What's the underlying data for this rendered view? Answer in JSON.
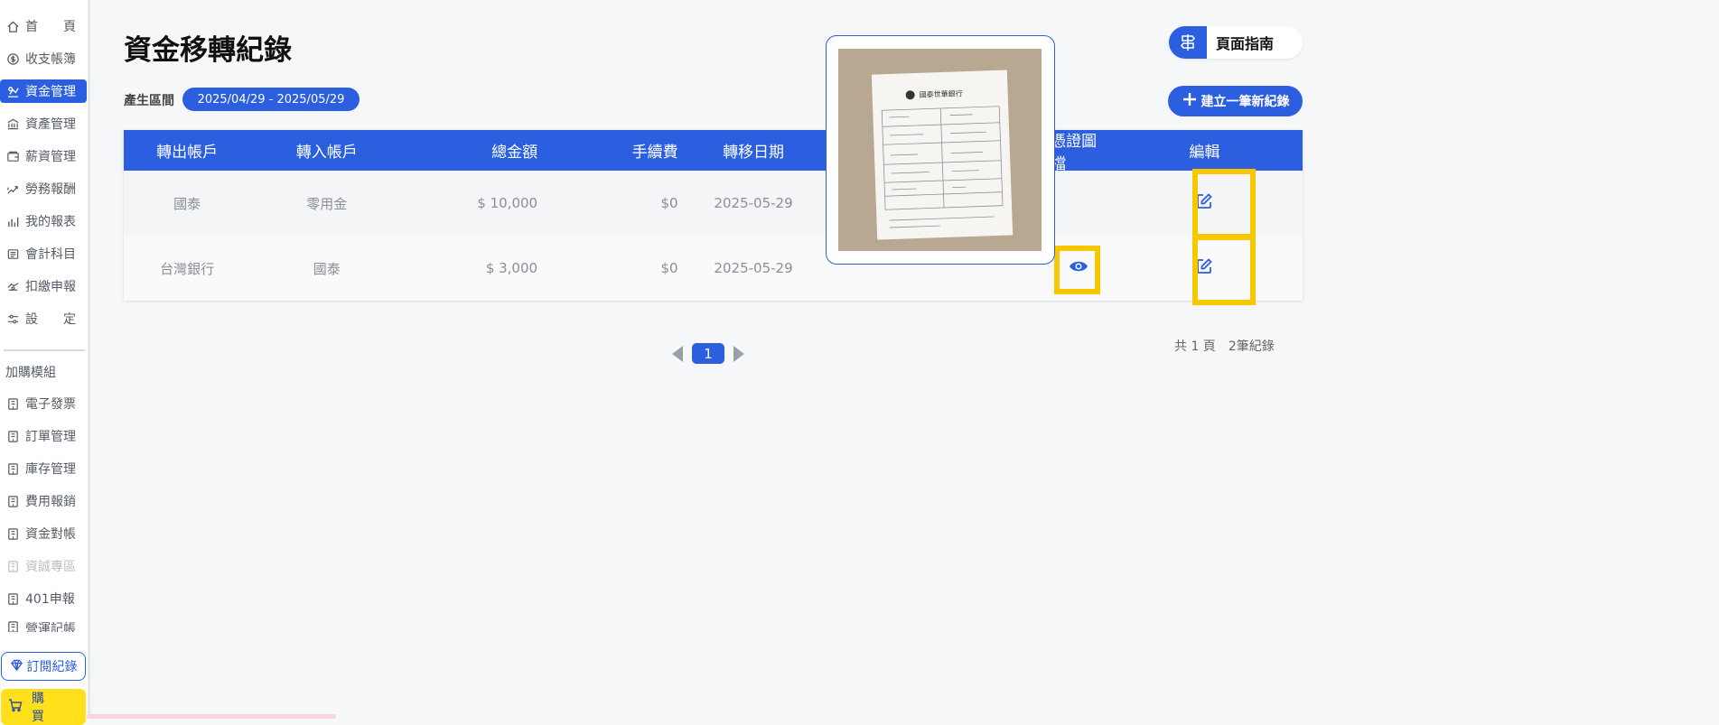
{
  "sidebar": {
    "items": [
      {
        "label": "首　　頁",
        "icon": "home-icon"
      },
      {
        "label": "收支帳簿",
        "icon": "dollar-circle-icon"
      },
      {
        "label": "資金管理",
        "icon": "transfer-icon"
      },
      {
        "label": "資產管理",
        "icon": "bank-icon"
      },
      {
        "label": "薪資管理",
        "icon": "wallet-icon"
      },
      {
        "label": "勞務報酬",
        "icon": "handshake-icon"
      },
      {
        "label": "我的報表",
        "icon": "chart-icon"
      },
      {
        "label": "會計科目",
        "icon": "ledger-icon"
      },
      {
        "label": "扣繳申報",
        "icon": "receipt-icon"
      },
      {
        "label": "設　　定",
        "icon": "sliders-icon"
      }
    ],
    "addon_section": "加購模組",
    "addon_items": [
      {
        "label": "電子發票",
        "icon": "module-icon"
      },
      {
        "label": "訂單管理",
        "icon": "module-icon"
      },
      {
        "label": "庫存管理",
        "icon": "module-icon"
      },
      {
        "label": "費用報銷",
        "icon": "module-icon"
      },
      {
        "label": "資金對帳",
        "icon": "module-icon"
      },
      {
        "label": "資誠專區",
        "icon": "module-icon"
      },
      {
        "label": "401申報",
        "icon": "module-icon"
      },
      {
        "label": "營運記帳",
        "icon": "module-icon"
      }
    ],
    "subscription_label": "訂閱紀錄",
    "buy_label": "購買"
  },
  "header": {
    "title": "資金移轉紀錄",
    "range_label": "產生區間",
    "range_value": "2025/04/29 - 2025/05/29",
    "guide_label": "頁面指南",
    "new_record_label": "建立一筆新紀錄"
  },
  "table": {
    "columns": [
      "轉出帳戶",
      "轉入帳戶",
      "總金額",
      "手續費",
      "轉移日期",
      "",
      "憑證圖檔",
      "編輯"
    ],
    "rows": [
      {
        "from": "國泰",
        "to": "零用金",
        "amount": "$ 10,000",
        "fee": "$0",
        "date": "2025-05-29",
        "has_image": false
      },
      {
        "from": "台灣銀行",
        "to": "國泰",
        "amount": "$ 3,000",
        "fee": "$0",
        "date": "2025-05-29",
        "has_image": true
      }
    ]
  },
  "pagination": {
    "current_page": "1",
    "total_pages_text": "共 1 頁",
    "total_records_text": "2筆紀錄"
  },
  "receipt_preview": {
    "bank_name": "國泰世華銀行"
  },
  "colors": {
    "primary": "#2b5fe0",
    "highlight": "#f7c800",
    "buy_button": "#ffe01a"
  }
}
